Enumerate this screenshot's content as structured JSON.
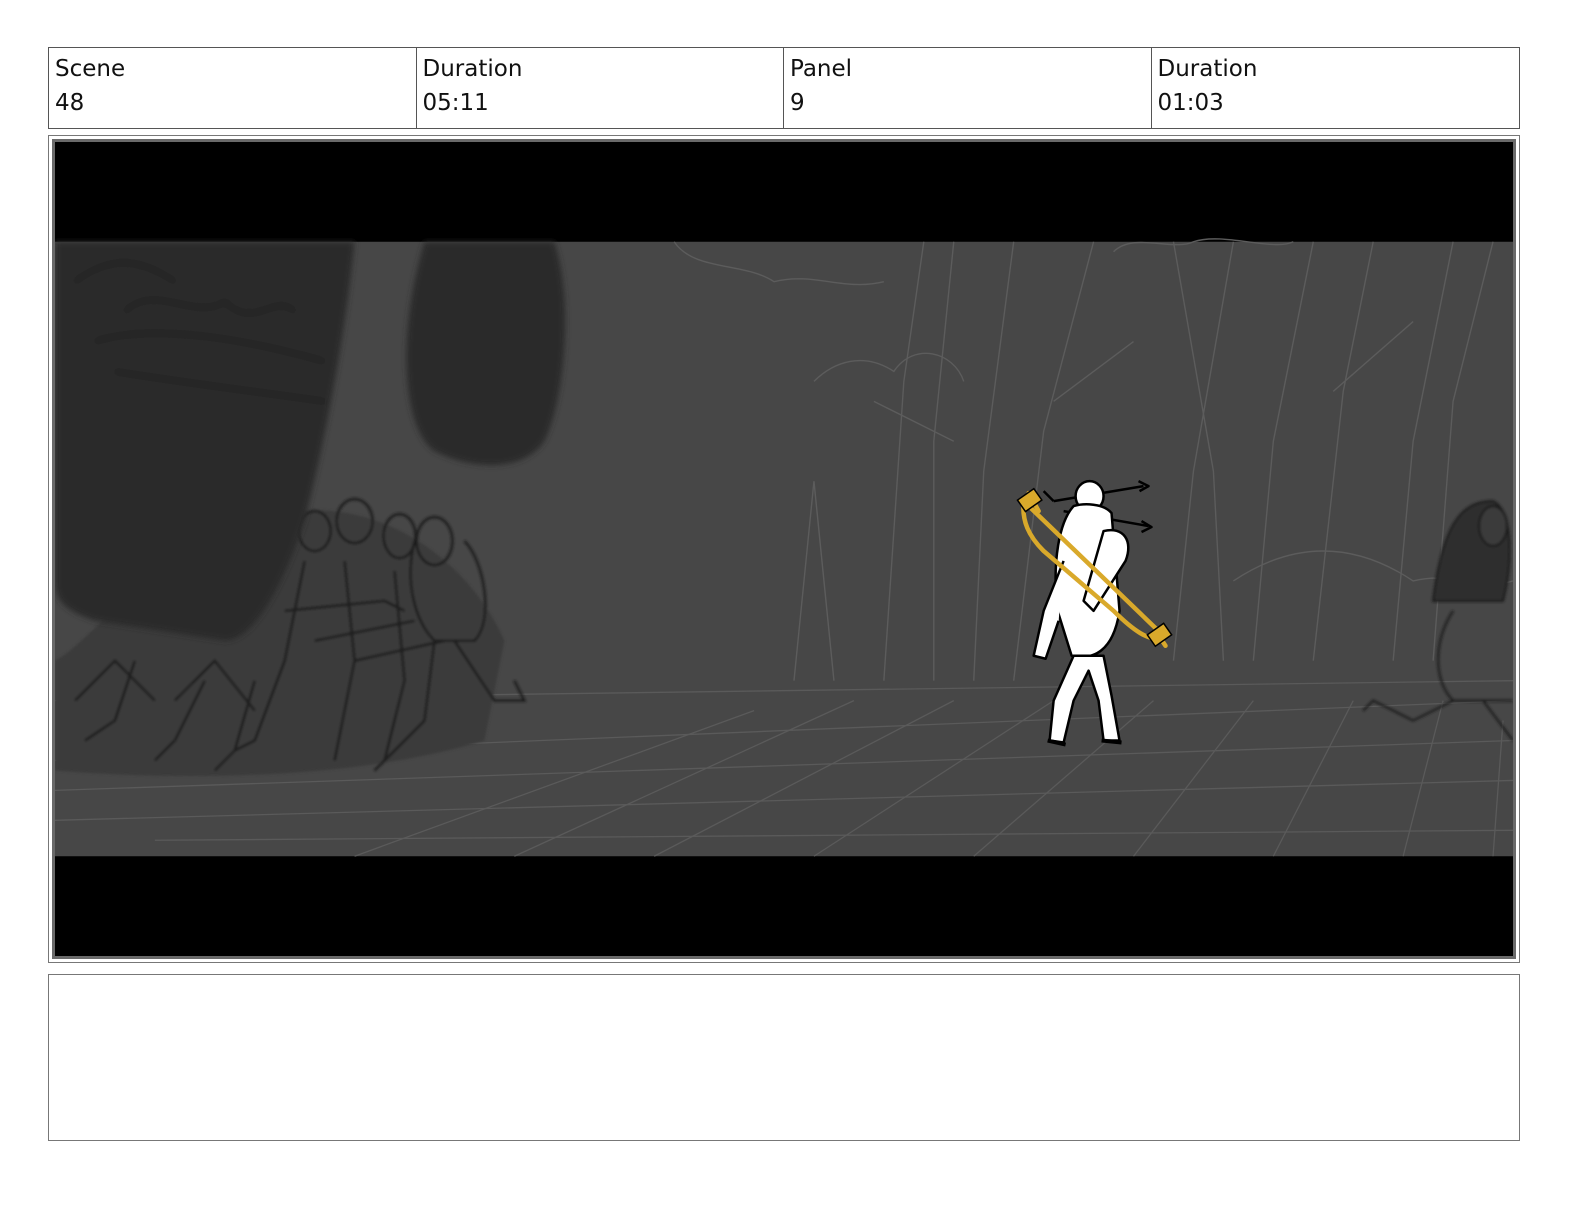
{
  "header": {
    "scene_label": "Scene",
    "scene_value": "48",
    "scene_duration_label": "Duration",
    "scene_duration_value": "05:11",
    "panel_label": "Panel",
    "panel_value": "9",
    "panel_duration_label": "Duration",
    "panel_duration_value": "01:03"
  },
  "panel": {
    "background_color": "#474747",
    "letterbox_color": "#000000",
    "accent_color": "#d9a92b"
  },
  "notes": {
    "text": ""
  }
}
